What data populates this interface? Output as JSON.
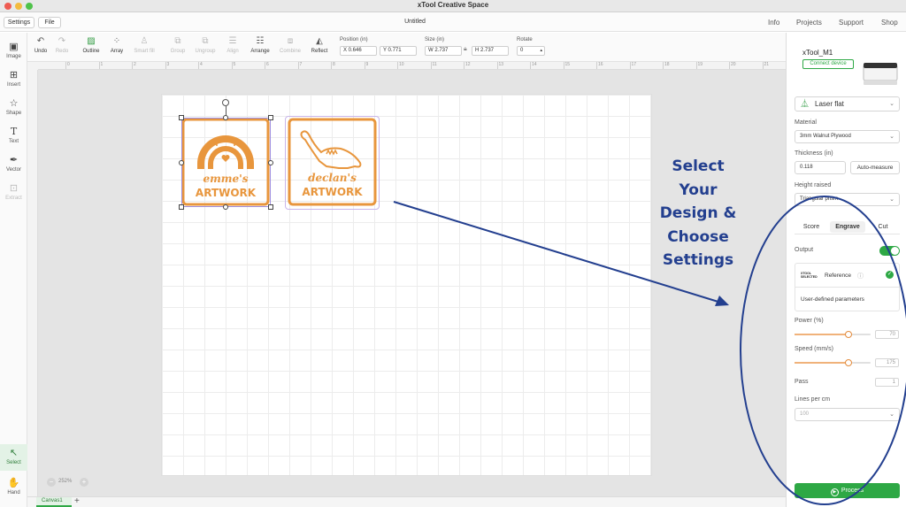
{
  "window": {
    "title": "xTool Creative Space"
  },
  "menubar": {
    "settings_label": "Settings",
    "file_label": "File",
    "doc_title": "Untitled",
    "links": [
      "Info",
      "Projects",
      "Support",
      "Shop"
    ]
  },
  "rail": {
    "items": [
      {
        "label": "Image",
        "icon": "image-icon"
      },
      {
        "label": "Insert",
        "icon": "insert-icon"
      },
      {
        "label": "Shape",
        "icon": "shape-icon"
      },
      {
        "label": "Text",
        "icon": "text-icon"
      },
      {
        "label": "Vector",
        "icon": "vector-icon"
      },
      {
        "label": "Extract",
        "icon": "extract-icon"
      }
    ],
    "select_label": "Select",
    "hand_label": "Hand"
  },
  "toolbar": {
    "undo": "Undo",
    "redo": "Redo",
    "outline": "Outline",
    "array": "Array",
    "smart_fill": "Smart fill",
    "group": "Group",
    "ungroup": "Ungroup",
    "align": "Align",
    "arrange": "Arrange",
    "combine": "Combine",
    "reflect": "Reflect",
    "position_label": "Position (in)",
    "x_value": "X  0.646",
    "y_value": "Y  0.771",
    "size_label": "Size (in)",
    "w_value": "W  2.737",
    "h_value": "H  2.737",
    "rotate_label": "Rotate",
    "rotate_value": "0"
  },
  "ruler": {
    "ticks": [
      "0",
      "1",
      "2",
      "3",
      "4",
      "5",
      "6",
      "7",
      "8",
      "9",
      "10",
      "11",
      "12",
      "13",
      "14",
      "15",
      "16",
      "17",
      "18",
      "19",
      "20",
      "21",
      "22",
      "23",
      "24",
      "25",
      "26",
      "27"
    ]
  },
  "canvas": {
    "zoom": "252%",
    "tab_label": "Canvas1",
    "design1": {
      "line1": "emme's",
      "line2": "ARTWORK"
    },
    "design2": {
      "line1": "declan's",
      "line2": "ARTWORK"
    }
  },
  "annotation": {
    "lines": [
      "Select",
      "Your",
      "Design &",
      "Choose",
      "Settings"
    ]
  },
  "panel": {
    "device_name": "xTool_M1",
    "connect_label": "Connect device",
    "mode_value": "Laser flat",
    "material_label": "Material",
    "material_value": "3mm Walnut Plywood",
    "thickness_label": "Thickness (in)",
    "thickness_value": "0.118",
    "auto_measure_label": "Auto-measure",
    "height_label": "Height raised",
    "height_value": "Triangular prism",
    "tabs": [
      "Score",
      "Engrave",
      "Cut"
    ],
    "output_label": "Output",
    "output_on": true,
    "logo_text": "XTOOL SELECTED",
    "reference_label": "Reference",
    "user_params_label": "User-defined parameters",
    "power_label": "Power (%)",
    "power_value": "70",
    "power_level": 0.7,
    "speed_label": "Speed (mm/s)",
    "speed_value": "175",
    "speed_level": 0.7,
    "pass_label": "Pass",
    "pass_value": "1",
    "lines_label": "Lines per cm",
    "lines_value": "100",
    "process_label": "Process"
  },
  "colors": {
    "accent_green": "#2ea845",
    "design_orange": "#e8963d",
    "annotation_blue": "#233f8f"
  }
}
